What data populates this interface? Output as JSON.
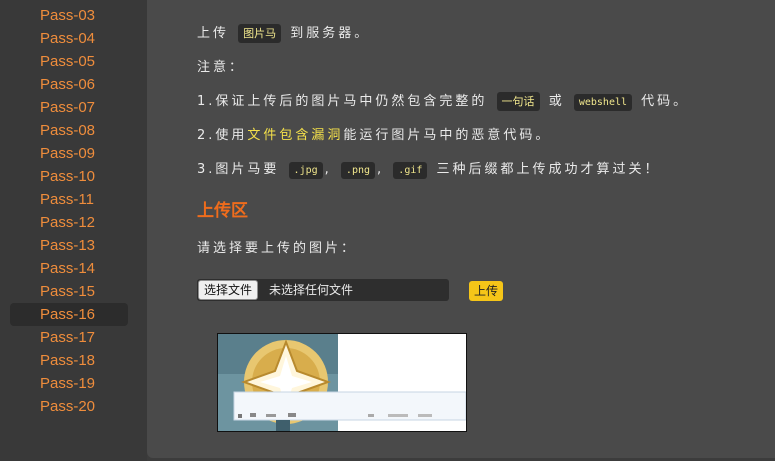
{
  "sidebar": {
    "items": [
      "Pass-03",
      "Pass-04",
      "Pass-05",
      "Pass-06",
      "Pass-07",
      "Pass-08",
      "Pass-09",
      "Pass-10",
      "Pass-11",
      "Pass-12",
      "Pass-13",
      "Pass-14",
      "Pass-15",
      "Pass-16",
      "Pass-17",
      "Pass-18",
      "Pass-19",
      "Pass-20"
    ],
    "active": "Pass-16"
  },
  "task": {
    "line1_pre": "上传",
    "line1_code": "图片马",
    "line1_post": "到服务器。",
    "note_label": "注意：",
    "item1_pre": "1.保证上传后的图片马中仍然包含完整的",
    "item1_code1": "一句话",
    "item1_mid": "或",
    "item1_code2": "webshell",
    "item1_post": "代码。",
    "item2_pre": "2.使用",
    "item2_highlight": "文件包含漏洞",
    "item2_post": "能运行图片马中的恶意代码。",
    "item3_pre": "3.图片马要",
    "item3_code1": ".jpg",
    "item3_sep1": ",",
    "item3_code2": ".png",
    "item3_sep2": ",",
    "item3_code3": ".gif",
    "item3_post": "三种后缀都上传成功才算过关！"
  },
  "upload": {
    "section_title": "上传区",
    "prompt": "请选择要上传的图片：",
    "choose_button": "选择文件",
    "file_status": "未选择任何文件",
    "submit_button": "上传"
  },
  "preview": {
    "icon": "star-badge-icon"
  }
}
